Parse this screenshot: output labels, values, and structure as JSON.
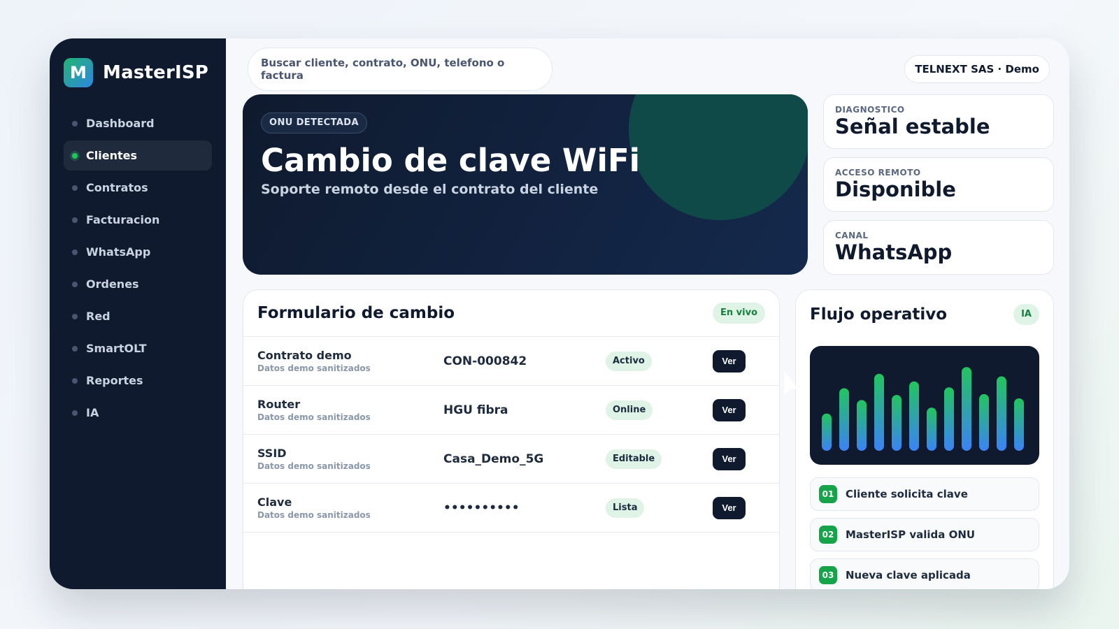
{
  "brand": {
    "logo_letter": "M",
    "name": "MasterISP"
  },
  "sidebar": {
    "items": [
      {
        "label": "Dashboard",
        "active": false
      },
      {
        "label": "Clientes",
        "active": true
      },
      {
        "label": "Contratos",
        "active": false
      },
      {
        "label": "Facturacion",
        "active": false
      },
      {
        "label": "WhatsApp",
        "active": false
      },
      {
        "label": "Ordenes",
        "active": false
      },
      {
        "label": "Red",
        "active": false
      },
      {
        "label": "SmartOLT",
        "active": false
      },
      {
        "label": "Reportes",
        "active": false
      },
      {
        "label": "IA",
        "active": false
      }
    ]
  },
  "topbar": {
    "search_placeholder": "Buscar cliente, contrato, ONU, telefono o factura",
    "org_label": "TELNEXT SAS · Demo"
  },
  "hero": {
    "badge": "ONU DETECTADA",
    "title": "Cambio de clave WiFi",
    "subtitle": "Soporte remoto desde el contrato del cliente"
  },
  "status_cards": [
    {
      "label": "DIAGNOSTICO",
      "value": "Señal estable"
    },
    {
      "label": "ACCESO REMOTO",
      "value": "Disponible"
    },
    {
      "label": "CANAL",
      "value": "WhatsApp"
    }
  ],
  "form": {
    "title": "Formulario de cambio",
    "badge": "En vivo",
    "button_label": "Ver",
    "rows": [
      {
        "label": "Contrato demo",
        "sub": "Datos demo sanitizados",
        "value": "CON-000842",
        "status": "Activo"
      },
      {
        "label": "Router",
        "sub": "Datos demo sanitizados",
        "value": "HGU fibra",
        "status": "Online"
      },
      {
        "label": "SSID",
        "sub": "Datos demo sanitizados",
        "value": "Casa_Demo_5G",
        "status": "Editable"
      },
      {
        "label": "Clave",
        "sub": "Datos demo sanitizados",
        "value": "••••••••••",
        "status": "Lista"
      }
    ]
  },
  "flow": {
    "title": "Flujo operativo",
    "badge": "IA",
    "bar_levels": [
      0.44,
      0.74,
      0.6,
      0.91,
      0.66,
      0.82,
      0.51,
      0.75,
      0.99,
      0.67,
      0.88,
      0.62
    ],
    "colors": {
      "bar_top": "#22c55e",
      "bar_bottom": "#3b82f6"
    },
    "steps": [
      {
        "num": "01",
        "text": "Cliente solicita clave"
      },
      {
        "num": "02",
        "text": "MasterISP valida ONU"
      },
      {
        "num": "03",
        "text": "Nueva clave aplicada"
      }
    ]
  }
}
